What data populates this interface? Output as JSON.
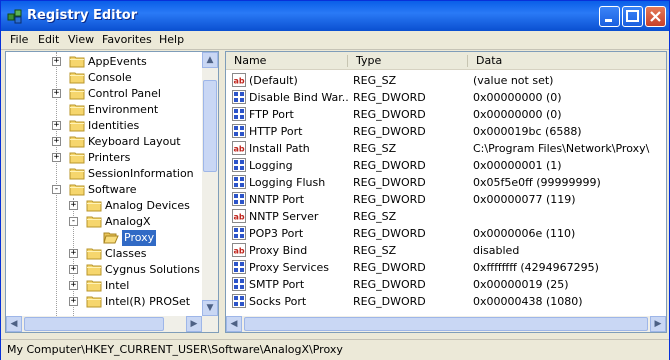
{
  "window": {
    "title": "Registry Editor"
  },
  "menu": [
    "File",
    "Edit",
    "View",
    "Favorites",
    "Help"
  ],
  "tree": [
    {
      "label": "AppEvents",
      "expander": "+",
      "level": 2
    },
    {
      "label": "Console",
      "expander": "",
      "level": 2
    },
    {
      "label": "Control Panel",
      "expander": "+",
      "level": 2
    },
    {
      "label": "Environment",
      "expander": "",
      "level": 2
    },
    {
      "label": "Identities",
      "expander": "+",
      "level": 2
    },
    {
      "label": "Keyboard Layout",
      "expander": "+",
      "level": 2
    },
    {
      "label": "Printers",
      "expander": "+",
      "level": 2
    },
    {
      "label": "SessionInformation",
      "expander": "",
      "level": 2
    },
    {
      "label": "Software",
      "expander": "-",
      "level": 2
    },
    {
      "label": "Analog Devices",
      "expander": "+",
      "level": 3
    },
    {
      "label": "AnalogX",
      "expander": "-",
      "level": 3
    },
    {
      "label": "Proxy",
      "expander": "",
      "level": 4,
      "selected": true
    },
    {
      "label": "Classes",
      "expander": "+",
      "level": 3
    },
    {
      "label": "Cygnus Solutions",
      "expander": "+",
      "level": 3
    },
    {
      "label": "Intel",
      "expander": "+",
      "level": 3
    },
    {
      "label": "Intel(R) PROSet",
      "expander": "+",
      "level": 3
    }
  ],
  "columns": {
    "name": "Name",
    "type": "Type",
    "data": "Data"
  },
  "values": [
    {
      "name": "(Default)",
      "type": "REG_SZ",
      "data": "(value not set)",
      "icon": "string"
    },
    {
      "name": "Disable Bind War...",
      "type": "REG_DWORD",
      "data": "0x00000000 (0)",
      "icon": "binary"
    },
    {
      "name": "FTP Port",
      "type": "REG_DWORD",
      "data": "0x00000000 (0)",
      "icon": "binary"
    },
    {
      "name": "HTTP Port",
      "type": "REG_DWORD",
      "data": "0x000019bc (6588)",
      "icon": "binary"
    },
    {
      "name": "Install Path",
      "type": "REG_SZ",
      "data": "C:\\Program Files\\Network\\Proxy\\",
      "icon": "string"
    },
    {
      "name": "Logging",
      "type": "REG_DWORD",
      "data": "0x00000001 (1)",
      "icon": "binary"
    },
    {
      "name": "Logging Flush",
      "type": "REG_DWORD",
      "data": "0x05f5e0ff (99999999)",
      "icon": "binary"
    },
    {
      "name": "NNTP Port",
      "type": "REG_DWORD",
      "data": "0x00000077 (119)",
      "icon": "binary"
    },
    {
      "name": "NNTP Server",
      "type": "REG_SZ",
      "data": "",
      "icon": "string"
    },
    {
      "name": "POP3 Port",
      "type": "REG_DWORD",
      "data": "0x0000006e (110)",
      "icon": "binary"
    },
    {
      "name": "Proxy Bind",
      "type": "REG_SZ",
      "data": "disabled",
      "icon": "string"
    },
    {
      "name": "Proxy Services",
      "type": "REG_DWORD",
      "data": "0xffffffff (4294967295)",
      "icon": "binary"
    },
    {
      "name": "SMTP Port",
      "type": "REG_DWORD",
      "data": "0x00000019 (25)",
      "icon": "binary"
    },
    {
      "name": "Socks Port",
      "type": "REG_DWORD",
      "data": "0x00000438 (1080)",
      "icon": "binary"
    }
  ],
  "status": "My Computer\\HKEY_CURRENT_USER\\Software\\AnalogX\\Proxy"
}
